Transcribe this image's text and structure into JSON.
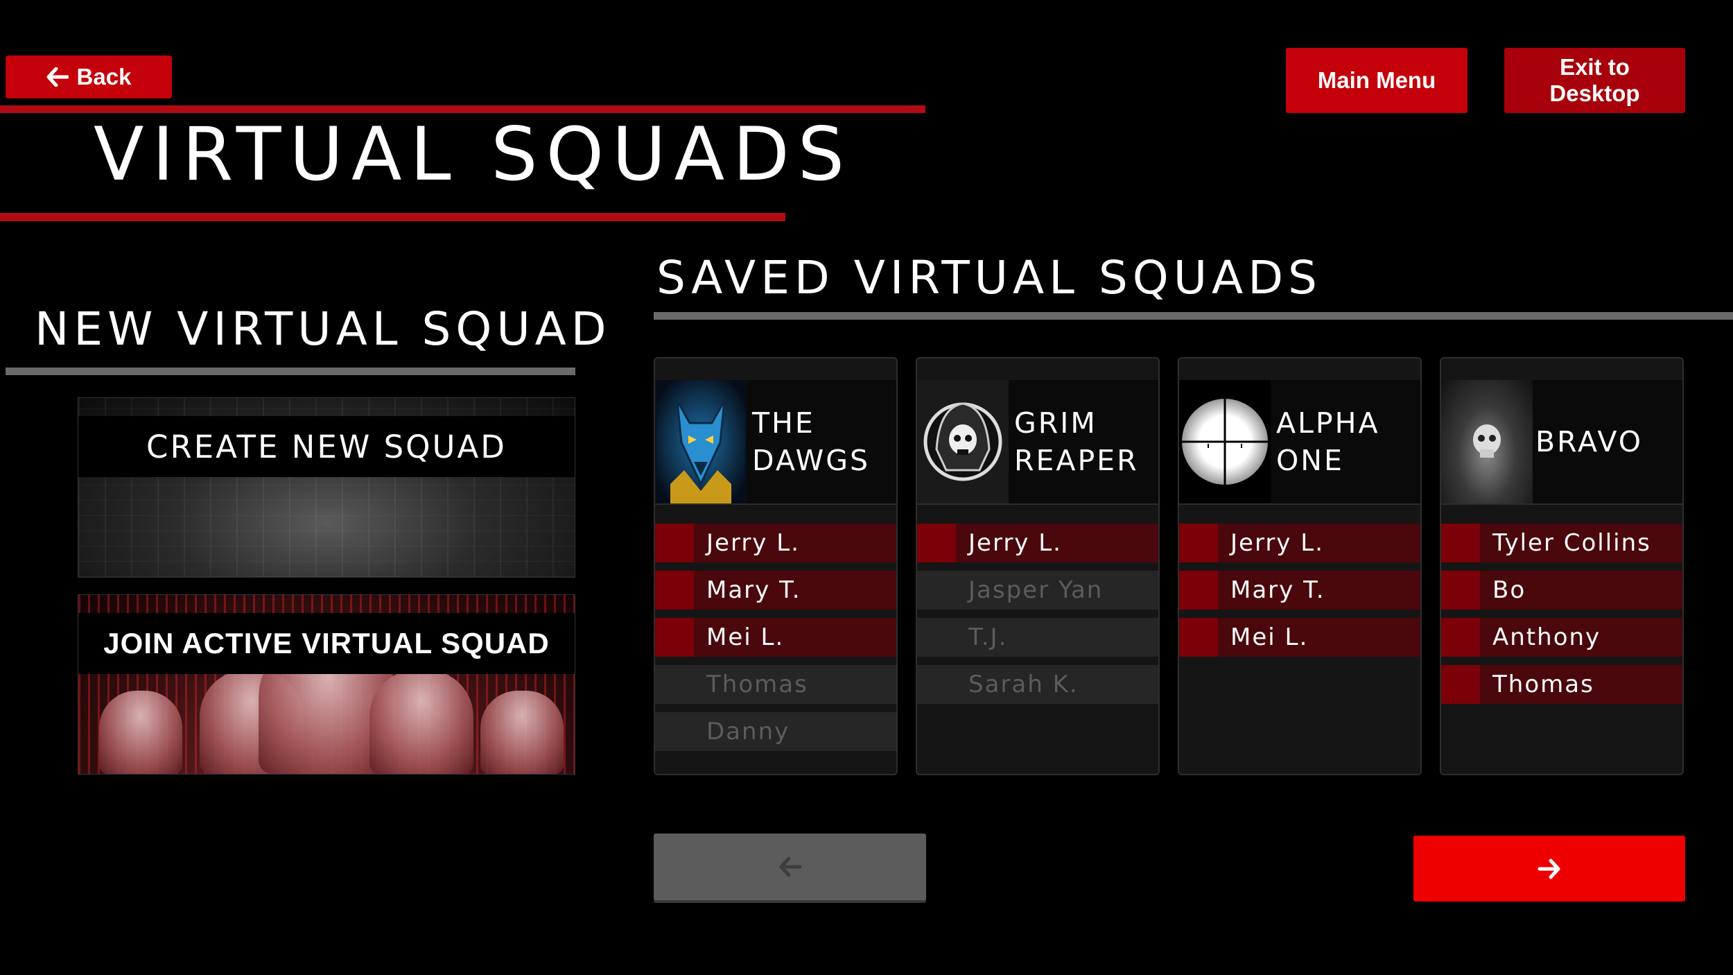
{
  "header": {
    "back_label": "Back",
    "main_menu_label": "Main Menu",
    "exit_label_line1": "Exit to",
    "exit_label_line2": "Desktop",
    "title": "VIRTUAL SQUADS"
  },
  "new_squad": {
    "heading": "NEW VIRTUAL SQUAD",
    "create_label": "CREATE NEW SQUAD",
    "join_label": "JOIN ACTIVE VIRTUAL SQUAD"
  },
  "saved": {
    "heading": "SAVED VIRTUAL SQUADS",
    "squads": [
      {
        "name_line1": "THE",
        "name_line2": "DAWGS",
        "logo_icon": "wolf-logo-icon",
        "members": [
          {
            "name": "Jerry L.",
            "active": true
          },
          {
            "name": "Mary T.",
            "active": true
          },
          {
            "name": "Mei L.",
            "active": true
          },
          {
            "name": "Thomas",
            "active": false
          },
          {
            "name": "Danny",
            "active": false
          }
        ]
      },
      {
        "name_line1": "GRIM",
        "name_line2": "REAPER",
        "logo_icon": "skull-reaper-icon",
        "members": [
          {
            "name": "Jerry L.",
            "active": true
          },
          {
            "name": "Jasper Yan",
            "active": false
          },
          {
            "name": "T.J.",
            "active": false
          },
          {
            "name": "Sarah K.",
            "active": false
          }
        ]
      },
      {
        "name_line1": "ALPHA",
        "name_line2": "ONE",
        "logo_icon": "crosshair-icon",
        "members": [
          {
            "name": "Jerry L.",
            "active": true
          },
          {
            "name": "Mary T.",
            "active": true
          },
          {
            "name": "Mei L.",
            "active": true
          }
        ]
      },
      {
        "name_line1": "BRAVO",
        "name_line2": "",
        "logo_icon": "skull-icon",
        "members": [
          {
            "name": "Tyler Collins",
            "active": true
          },
          {
            "name": "Bo",
            "active": true
          },
          {
            "name": "Anthony",
            "active": true
          },
          {
            "name": "Thomas",
            "active": true
          }
        ]
      }
    ]
  },
  "pagination": {
    "prev_icon": "arrow-left-icon",
    "next_icon": "arrow-right-icon"
  },
  "colors": {
    "accent_red": "#c4000a",
    "next_red": "#ef0000",
    "member_active": "#4a080c",
    "member_inactive": "#262626"
  }
}
